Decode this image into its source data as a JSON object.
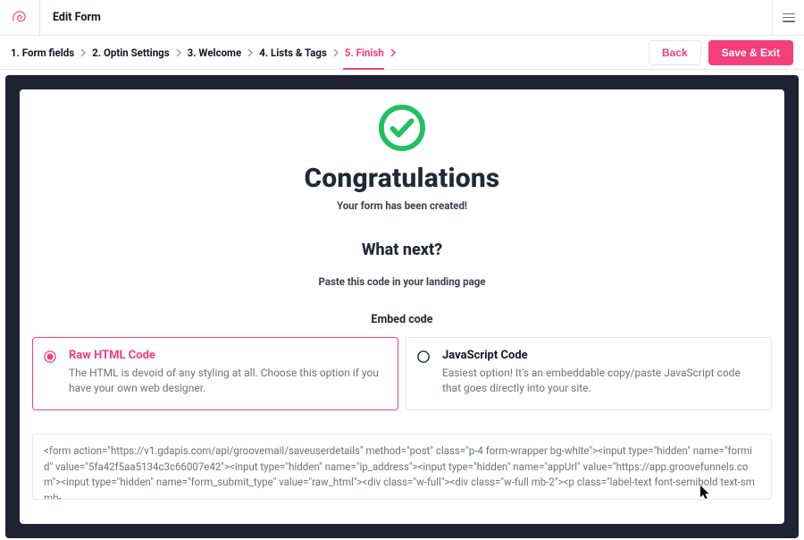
{
  "header": {
    "page_title": "Edit Form"
  },
  "breadcrumb": {
    "items": [
      {
        "label": "1. Form fields",
        "active": false
      },
      {
        "label": "2. Optin Settings",
        "active": false
      },
      {
        "label": "3. Welcome",
        "active": false
      },
      {
        "label": "4. Lists & Tags",
        "active": false
      },
      {
        "label": "5. Finish",
        "active": true
      }
    ],
    "back_label": "Back",
    "save_label": "Save & Exit"
  },
  "main": {
    "congrats_heading": "Congratulations",
    "congrats_sub": "Your form has been created!",
    "what_next_heading": "What next?",
    "paste_hint": "Paste this code in your landing page",
    "embed_label": "Embed code",
    "options": [
      {
        "title": "Raw HTML Code",
        "description": "The HTML is devoid of any styling at all. Choose this option if you have your own web designer.",
        "selected": true
      },
      {
        "title": "JavaScript Code",
        "description": "Easiest option! It's an embeddable copy/paste JavaScript code that goes directly into your site.",
        "selected": false
      }
    ],
    "code_snippet": "<form action=\"https://v1.gdapis.com/api/groovemail/saveuserdetails\" method=\"post\" class=\"p-4 form-wrapper bg-white\"><input type=\"hidden\" name=\"formid\" value=\"5fa42f5aa5134c3c66007e42\"><input type=\"hidden\" name=\"ip_address\"><input type=\"hidden\" name=\"appUrl\" value=\"https://app.groovefunnels.com\"><input type=\"hidden\" name=\"form_submit_type\" value=\"raw_html\"><div class=\"w-full\"><div class=\"w-full mb-2\"><p class=\"label-text font-semibold text-sm mb-"
  },
  "colors": {
    "accent": "#f43f7a",
    "success": "#21c161",
    "muted": "#6b7280",
    "border": "#e5e7eb",
    "dark_frame": "#1e2233"
  }
}
